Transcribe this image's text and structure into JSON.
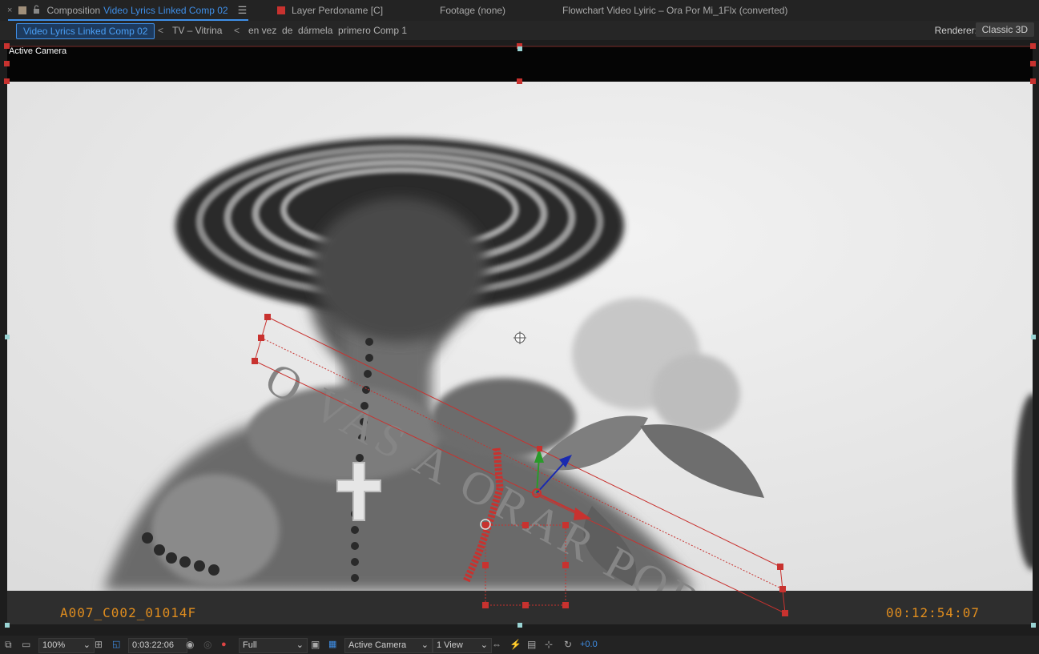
{
  "tabs": {
    "close_glyph": "×",
    "comp_prefix": "Composition",
    "comp_name": "Video Lyrics Linked Comp 02",
    "menu_glyph": "☰",
    "layer_tab": "Layer Perdoname [C]",
    "footage_tab": "Footage (none)",
    "flowchart_tab": "Flowchart Video Lyiric – Ora Por Mi_1Flx (converted)",
    "comp_swatch_color": "#a08f7a",
    "layer_swatch_color": "#c8322f"
  },
  "breadcrumb": {
    "items": [
      "Video Lyrics Linked Comp 02",
      "TV – Vitrina",
      "en vez  de  dármela  primero Comp 1"
    ],
    "chevron": "<",
    "renderer_label": "Renderer:",
    "renderer_value": "Classic 3D"
  },
  "viewer": {
    "view_label": "Active Camera",
    "timecode_left": "A007_C002_01014F",
    "timecode_right": "00:12:54:07",
    "lyric_text": "O VAS A ORAR POR MI",
    "accent_color": "#e08d1e",
    "handle_color": "#c8322f"
  },
  "statusbar": {
    "zoom": "100%",
    "timecode": "0:03:22:06",
    "resolution": "Full",
    "view": "Active Camera",
    "layout": "1 View",
    "exposure": "+0.0"
  }
}
